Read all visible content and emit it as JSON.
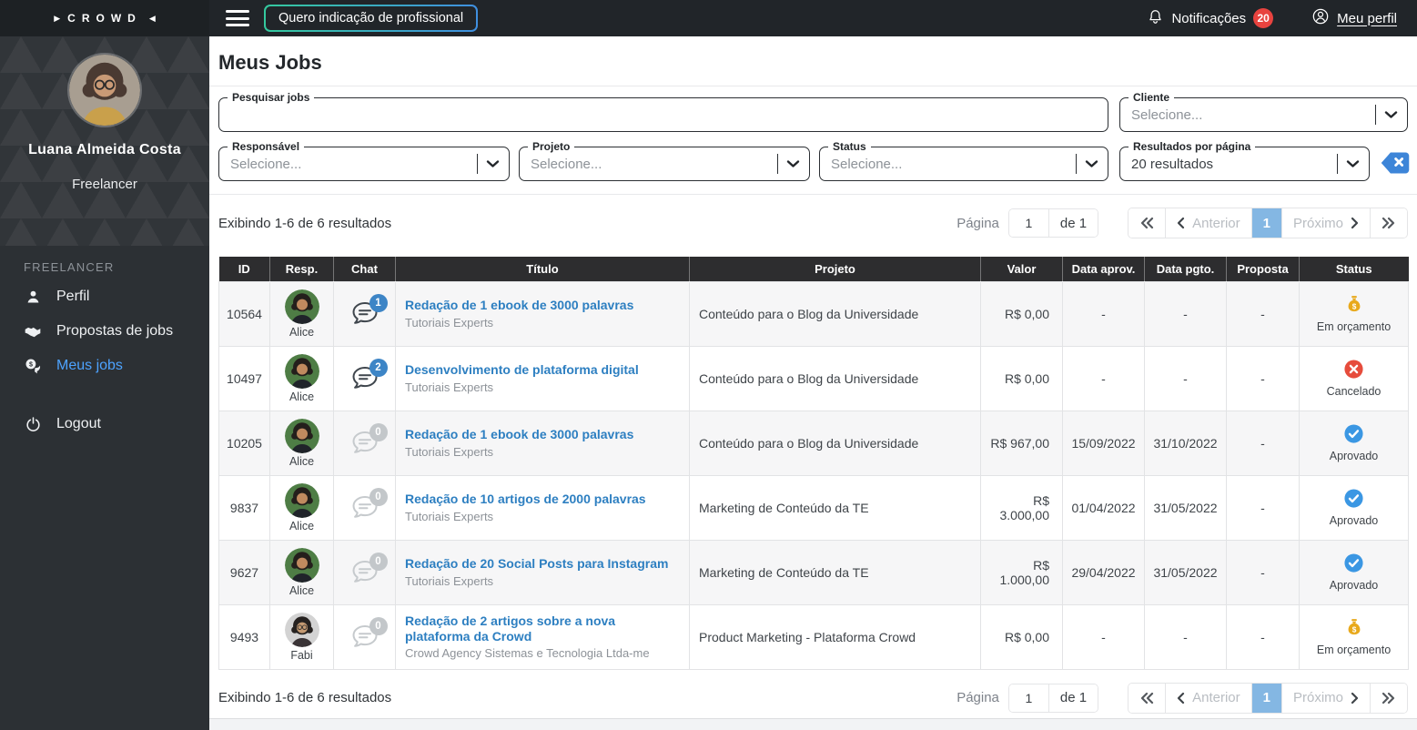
{
  "topbar": {
    "logo_prefix": "▶",
    "logo": "CROWD",
    "logo_suffix": "◀",
    "cta_label": "Quero indicação de profissional",
    "notifications_label": "Notificações",
    "notifications_count": "20",
    "profile_label": "Meu perfil"
  },
  "sidebar": {
    "user_name": "Luana Almeida Costa",
    "user_role": "Freelancer",
    "section_label": "FREELANCER",
    "items": [
      {
        "name": "perfil",
        "label": "Perfil",
        "icon": "person-icon",
        "active": false
      },
      {
        "name": "propostas-de-jobs",
        "label": "Propostas de jobs",
        "icon": "handshake-icon",
        "active": false
      },
      {
        "name": "meus-jobs",
        "label": "Meus jobs",
        "icon": "chat-money-icon",
        "active": true
      },
      {
        "name": "logout",
        "label": "Logout",
        "icon": "power-icon",
        "active": false,
        "separated": true
      }
    ]
  },
  "page": {
    "title": "Meus Jobs"
  },
  "filters": {
    "search": {
      "label": "Pesquisar jobs",
      "value": ""
    },
    "cliente": {
      "label": "Cliente",
      "value": "Selecione..."
    },
    "responsavel": {
      "label": "Responsável",
      "value": "Selecione..."
    },
    "projeto": {
      "label": "Projeto",
      "value": "Selecione..."
    },
    "status": {
      "label": "Status",
      "value": "Selecione..."
    },
    "per_page": {
      "label": "Resultados por página",
      "value": "20 resultados"
    }
  },
  "results_bar": {
    "summary": "Exibindo 1-6 de 6 resultados",
    "page_label": "Página",
    "page_value": "1",
    "of_label": "de 1",
    "prev_label": "Anterior",
    "next_label": "Próximo",
    "current_page": "1"
  },
  "table": {
    "headers": [
      "ID",
      "Resp.",
      "Chat",
      "Título",
      "Projeto",
      "Valor",
      "Data aprov.",
      "Data pgto.",
      "Proposta",
      "Status"
    ],
    "rows": [
      {
        "id": "10564",
        "resp": "Alice",
        "chat_count": "1",
        "title": "Redação de 1 ebook de 3000 palavras",
        "subtitle": "Tutoriais Experts",
        "project": "Conteúdo para o Blog da Universidade",
        "value": "R$ 0,00",
        "approved": "-",
        "paid": "-",
        "proposal": "-",
        "status": "Em orçamento",
        "status_type": "budget"
      },
      {
        "id": "10497",
        "resp": "Alice",
        "chat_count": "2",
        "title": "Desenvolvimento de plataforma digital",
        "subtitle": "Tutoriais Experts",
        "project": "Conteúdo para o Blog da Universidade",
        "value": "R$ 0,00",
        "approved": "-",
        "paid": "-",
        "proposal": "-",
        "status": "Cancelado",
        "status_type": "cancelled"
      },
      {
        "id": "10205",
        "resp": "Alice",
        "chat_count": "0",
        "title": "Redação de 1 ebook de 3000 palavras",
        "subtitle": "Tutoriais Experts",
        "project": "Conteúdo para o Blog da Universidade",
        "value": "R$ 967,00",
        "approved": "15/09/2022",
        "paid": "31/10/2022",
        "proposal": "-",
        "status": "Aprovado",
        "status_type": "approved"
      },
      {
        "id": "9837",
        "resp": "Alice",
        "chat_count": "0",
        "title": "Redação de 10 artigos de 2000 palavras",
        "subtitle": "Tutoriais Experts",
        "project": "Marketing de Conteúdo da TE",
        "value": "R$ 3.000,00",
        "approved": "01/04/2022",
        "paid": "31/05/2022",
        "proposal": "-",
        "status": "Aprovado",
        "status_type": "approved"
      },
      {
        "id": "9627",
        "resp": "Alice",
        "chat_count": "0",
        "title": "Redação de 20 Social Posts para Instagram",
        "subtitle": "Tutoriais Experts",
        "project": "Marketing de Conteúdo da TE",
        "value": "R$ 1.000,00",
        "approved": "29/04/2022",
        "paid": "31/05/2022",
        "proposal": "-",
        "status": "Aprovado",
        "status_type": "approved"
      },
      {
        "id": "9493",
        "resp": "Fabi",
        "chat_count": "0",
        "title": "Redação de 2 artigos sobre a nova plataforma da Crowd",
        "subtitle": "Crowd Agency Sistemas e Tecnologia Ltda-me",
        "project": "Product Marketing - Plataforma Crowd",
        "value": "R$ 0,00",
        "approved": "-",
        "paid": "-",
        "proposal": "-",
        "status": "Em orçamento",
        "status_type": "budget"
      }
    ]
  },
  "colors": {
    "link_blue": "#2d7fc1",
    "sidebar_active_blue": "#4da3ff",
    "badge_red": "#e8433f",
    "chat_badge_blue": "#3d85c6",
    "approved_blue": "#3b97e3",
    "cancelled_red": "#e64c3c",
    "budget_gold": "#e8a91c",
    "pagination_active": "#84b7e3",
    "cta_gradient_start": "#34c99e",
    "cta_gradient_end": "#3f8fe0"
  }
}
